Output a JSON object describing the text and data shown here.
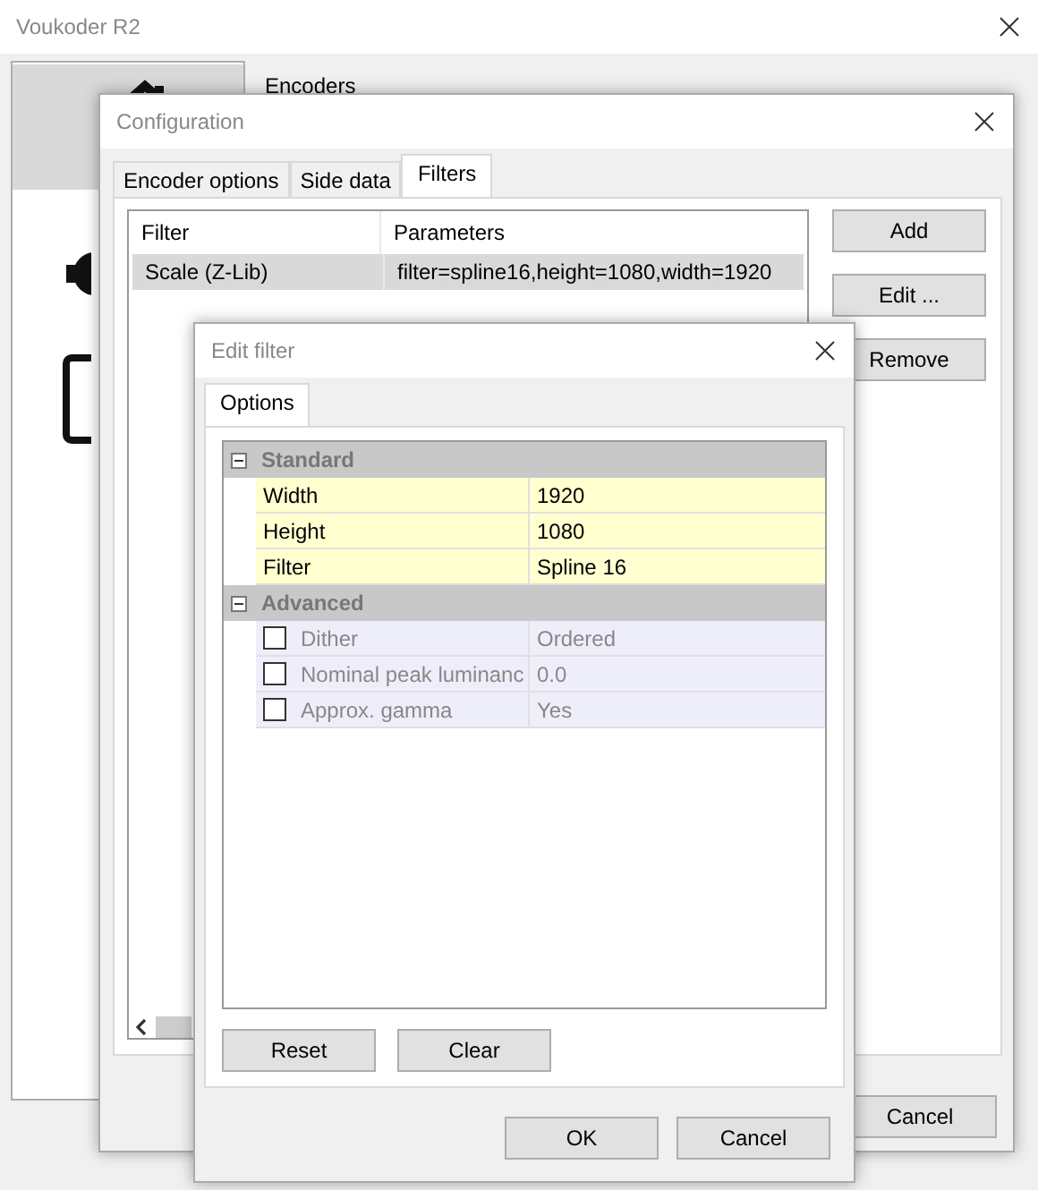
{
  "main_window": {
    "title": "Voukoder R2",
    "group_label": "Encoders"
  },
  "configuration": {
    "title": "Configuration",
    "tabs": [
      {
        "label": "Encoder options",
        "selected": false
      },
      {
        "label": "Side data",
        "selected": false
      },
      {
        "label": "Filters",
        "selected": true
      }
    ],
    "columns": [
      "Filter",
      "Parameters"
    ],
    "rows": [
      {
        "cells": [
          "Scale (Z-Lib)",
          "filter=spline16,height=1080,width=1920"
        ],
        "selected": true
      }
    ],
    "side_buttons": [
      "Add",
      "Edit ...",
      "Remove"
    ],
    "footer_buttons": [
      "Cancel"
    ]
  },
  "edit_filter": {
    "title": "Edit filter",
    "tabs": [
      {
        "label": "Options",
        "selected": true
      }
    ],
    "groups": [
      {
        "name": "Standard",
        "expanded": true,
        "properties": [
          {
            "kind": "plain",
            "name": "Width",
            "value": "1920"
          },
          {
            "kind": "plain",
            "name": "Height",
            "value": "1080"
          },
          {
            "kind": "plain",
            "name": "Filter",
            "value": "Spline 16"
          }
        ]
      },
      {
        "name": "Advanced",
        "expanded": true,
        "properties": [
          {
            "kind": "optional",
            "checked": false,
            "name": "Dither",
            "value": "Ordered"
          },
          {
            "kind": "optional",
            "checked": false,
            "name": "Nominal peak luminanc",
            "value": "0.0"
          },
          {
            "kind": "optional",
            "checked": false,
            "name": "Approx. gamma",
            "value": "Yes"
          }
        ]
      }
    ],
    "grid_buttons": [
      "Reset",
      "Clear"
    ],
    "footer_buttons": [
      "OK",
      "Cancel"
    ]
  }
}
